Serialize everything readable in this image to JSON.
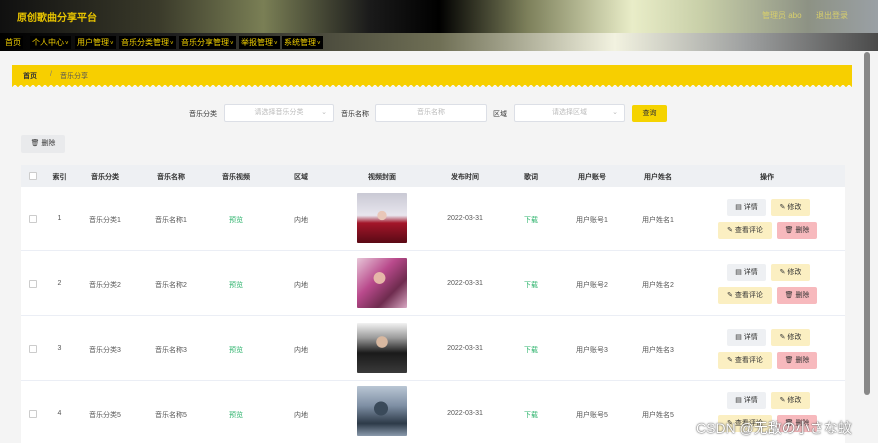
{
  "header": {
    "title": "原创歌曲分享平台",
    "user": "管理员 abo",
    "logout": "退出登录"
  },
  "nav": [
    "首页",
    "个人中心",
    "用户管理",
    "音乐分类管理",
    "音乐分享管理",
    "举报管理",
    "系统管理"
  ],
  "breadcrumb": {
    "home": "首页",
    "separator": "/",
    "current": "音乐分享"
  },
  "search": {
    "category_label": "音乐分类",
    "category_placeholder": "请选择音乐分类",
    "name_label": "音乐名称",
    "name_placeholder": "音乐名称",
    "region_label": "区域",
    "region_placeholder": "请选择区域",
    "search_button": "查询"
  },
  "delete_button": "删除",
  "table": {
    "headers": [
      "索引",
      "音乐分类",
      "音乐名称",
      "音乐视频",
      "区域",
      "视频封面",
      "发布时间",
      "歌词",
      "用户账号",
      "用户姓名",
      "操作"
    ],
    "rows": [
      {
        "index": "1",
        "category": "音乐分类1",
        "name": "音乐名称1",
        "video": "预览",
        "region": "内地",
        "date": "2022-03-31",
        "lyrics": "下载",
        "account": "用户账号1",
        "username": "用户姓名1"
      },
      {
        "index": "2",
        "category": "音乐分类2",
        "name": "音乐名称2",
        "video": "预览",
        "region": "内地",
        "date": "2022-03-31",
        "lyrics": "下载",
        "account": "用户账号2",
        "username": "用户姓名2"
      },
      {
        "index": "3",
        "category": "音乐分类3",
        "name": "音乐名称3",
        "video": "预览",
        "region": "内地",
        "date": "2022-03-31",
        "lyrics": "下载",
        "account": "用户账号3",
        "username": "用户姓名3"
      },
      {
        "index": "4",
        "category": "音乐分类5",
        "name": "音乐名称5",
        "video": "预览",
        "region": "内地",
        "date": "2022-03-31",
        "lyrics": "下载",
        "account": "用户账号5",
        "username": "用户姓名5"
      }
    ],
    "actions": {
      "detail": "详情",
      "edit": "修改",
      "comments": "查看评论",
      "delete": "删除"
    }
  },
  "watermark": "CSDN @无敌の小さな蚊",
  "colors": {
    "accent": "#f5d300",
    "link_green": "#2db36c",
    "delete_bg": "#f7b9bd",
    "edit_bg": "#fbefc2"
  }
}
